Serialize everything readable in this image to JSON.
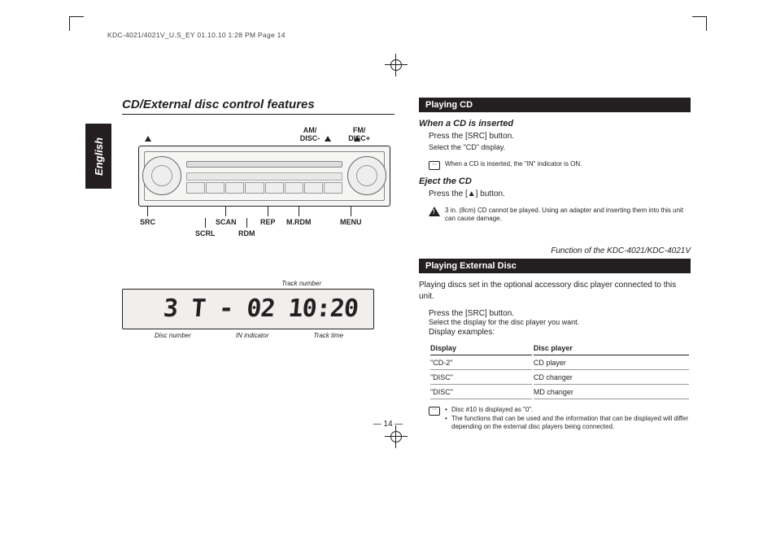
{
  "print_header": "KDC-4021/4021V_U.S_EY  01.10.10  1:28 PM  Page 14",
  "lang_tab": "English",
  "section_title": "CD/External disc control features",
  "top_labels": {
    "left": "AM/\nDISC-",
    "right": "FM/\nDISC+"
  },
  "bottom_labels": [
    "SRC",
    "SCRL",
    "SCAN",
    "RDM",
    "REP",
    "M.RDM",
    "MENU"
  ],
  "display_annotations": {
    "top": "Track number",
    "disc": "Disc number",
    "in": "IN indicator",
    "time": "Track time"
  },
  "display_text": "3 T - 02 10:20",
  "playing_cd": {
    "bar": "Playing CD",
    "sub1": "When a CD is inserted",
    "body1a": "Press the [SRC] button.",
    "body1b": "Select the \"CD\" display.",
    "note1": "When a CD is inserted, the \"IN\" indicator is ON.",
    "sub2": "Eject the CD",
    "body2": "Press the [▲] button.",
    "warn": "3 in. (8cm) CD cannot be played. Using an adapter and inserting them into this unit can cause damage."
  },
  "func_line": "Function of the KDC-4021/KDC-4021V",
  "external": {
    "bar": "Playing External Disc",
    "intro": "Playing discs set in the optional accessory disc player connected to this unit.",
    "body1": "Press the [SRC] button.",
    "body2": "Select the display for the disc player you want.",
    "body3": "Display examples:",
    "th1": "Display",
    "th2": "Disc player",
    "rows": [
      {
        "d": "\"CD-2\"",
        "p": "CD player"
      },
      {
        "d": "\"DISC\"",
        "p": "CD changer"
      },
      {
        "d": "\"DISC\"",
        "p": "MD changer"
      }
    ],
    "notes": [
      "Disc #10 is displayed as \"0\".",
      "The functions that can be used and the information that can be displayed will differ depending on the external disc players being connected."
    ]
  },
  "page_num": "— 14 —"
}
